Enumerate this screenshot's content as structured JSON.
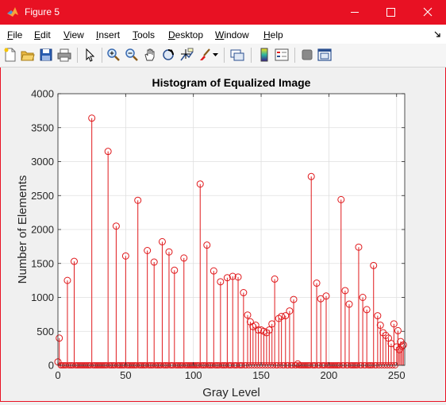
{
  "window": {
    "title": "Figure 5"
  },
  "menu": [
    "File",
    "Edit",
    "View",
    "Insert",
    "Tools",
    "Desktop",
    "Window",
    "Help"
  ],
  "toolbar_icons": [
    "new-figure-icon",
    "open-file-icon",
    "save-icon",
    "print-icon",
    "select-arrow-icon",
    "zoom-in-icon",
    "zoom-out-icon",
    "pan-hand-icon",
    "rotate-3d-icon",
    "data-cursor-icon",
    "brush-icon",
    "link-plot-icon",
    "colorbar-icon",
    "legend-icon",
    "hide-plot-tools-icon",
    "show-plot-tools-icon"
  ],
  "accent_color": "#e81123",
  "chart_data": {
    "type": "stem",
    "title": "Histogram of Equalized Image",
    "xlabel": "Gray Level",
    "ylabel": "Number of Elements",
    "xlim": [
      0,
      256
    ],
    "ylim": [
      0,
      4000
    ],
    "xticks": [
      "0",
      "50",
      "100",
      "150",
      "200",
      "250"
    ],
    "yticks": [
      "0",
      "500",
      "1000",
      "1500",
      "2000",
      "2500",
      "3000",
      "3500",
      "4000"
    ],
    "grid": true,
    "marker": "open-circle",
    "color": "#e0191c",
    "series": [
      {
        "x": [
          0,
          1,
          7,
          12,
          25,
          37,
          43,
          50,
          59,
          66,
          71,
          77,
          82,
          86,
          93,
          105,
          110,
          115,
          120,
          125,
          129,
          133,
          137,
          140,
          142,
          144,
          146,
          148,
          150,
          152,
          154,
          156,
          158,
          160,
          163,
          165,
          168,
          171,
          174,
          177,
          187,
          191,
          194,
          198,
          209,
          212,
          215,
          222,
          225,
          228,
          233,
          236,
          238,
          240,
          242,
          244,
          246,
          248,
          250,
          251,
          252,
          253,
          254,
          255
        ],
        "y": [
          50,
          400,
          1250,
          1530,
          3640,
          3150,
          2050,
          1610,
          2430,
          1690,
          1520,
          1820,
          1670,
          1400,
          1580,
          2670,
          1770,
          1390,
          1230,
          1290,
          1310,
          1300,
          1070,
          740,
          640,
          570,
          590,
          520,
          520,
          500,
          480,
          520,
          610,
          1270,
          690,
          720,
          730,
          800,
          970,
          20,
          2780,
          1210,
          980,
          1020,
          2440,
          1100,
          900,
          1740,
          1000,
          820,
          1470,
          730,
          590,
          480,
          440,
          400,
          320,
          610,
          270,
          510,
          230,
          350,
          280,
          300
        ]
      }
    ]
  }
}
